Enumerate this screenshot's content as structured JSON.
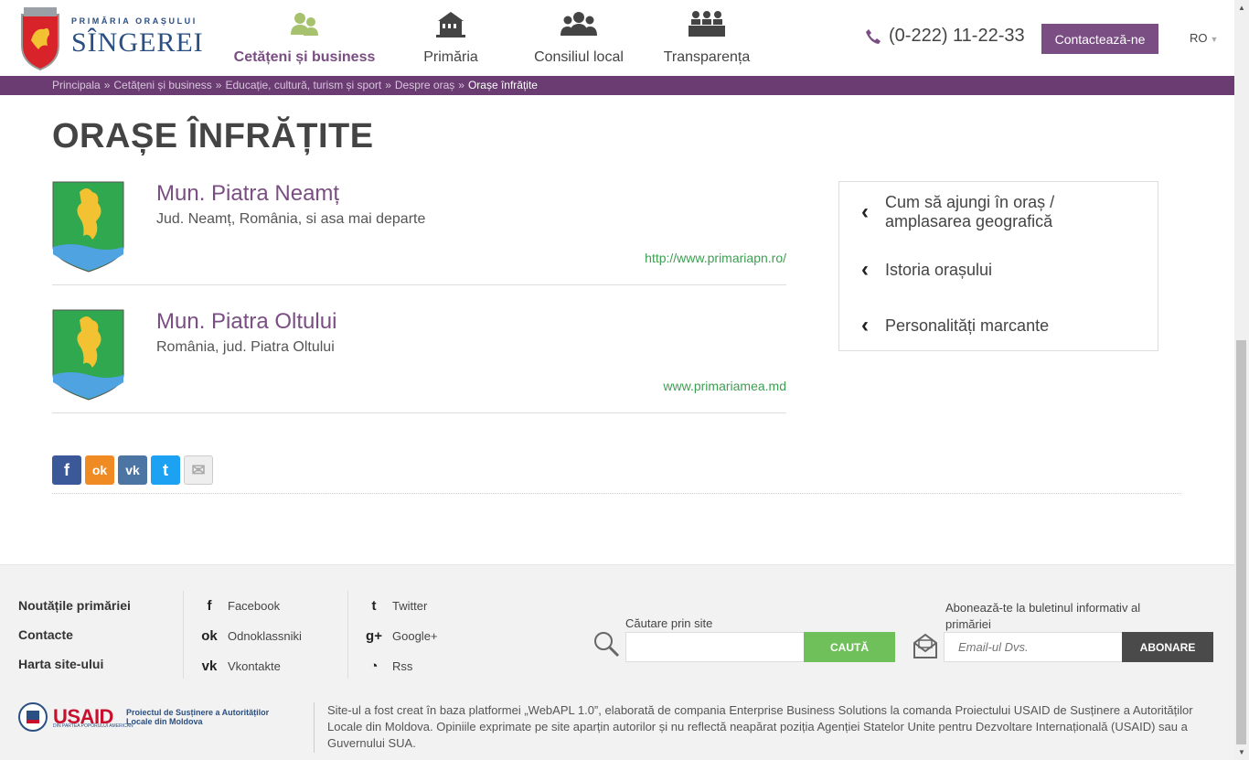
{
  "header": {
    "logo_small": "PRIMĂRIA ORAȘULUI",
    "logo_big": "SÎNGEREI",
    "nav": [
      {
        "label": "Cetățeni și business",
        "icon": "citizens-icon",
        "active": true
      },
      {
        "label": "Primăria",
        "icon": "building-icon",
        "active": false
      },
      {
        "label": "Consiliul local",
        "icon": "council-icon",
        "active": false
      },
      {
        "label": "Transparența",
        "icon": "meeting-icon",
        "active": false
      }
    ],
    "phone": "(0-222) 11-22-33",
    "contact_label": "Contactează-ne",
    "lang": "RO"
  },
  "breadcrumb": {
    "items": [
      "Principala",
      "Cetățeni și business",
      "Educație, cultură, turism și sport",
      "Despre oraș"
    ],
    "separator": "»",
    "current": "Orașe înfrățite"
  },
  "main": {
    "title": "ORAȘE ÎNFRĂȚITE",
    "cities": [
      {
        "name": "Mun. Piatra Neamț",
        "desc": "Jud. Neamț, România, si asa mai departe",
        "url": "http://www.primariapn.ro/"
      },
      {
        "name": "Mun. Piatra Oltului",
        "desc": "România, jud. Piatra Oltului",
        "url": "www.primariamea.md"
      }
    ],
    "side_menu": [
      {
        "label_line1": "Cum să ajungi în oraș /",
        "label_line2": "amplasarea geografică"
      },
      {
        "label_line1": "Istoria orașului",
        "label_line2": ""
      },
      {
        "label_line1": "Personalități marcante",
        "label_line2": ""
      }
    ],
    "share": [
      {
        "name": "facebook-share",
        "glyph": "f",
        "color": "#3b5998"
      },
      {
        "name": "odnoklassniki-share",
        "glyph": "ok",
        "color": "#f08a22"
      },
      {
        "name": "vkontakte-share",
        "glyph": "vk",
        "color": "#4c75a3"
      },
      {
        "name": "twitter-share",
        "glyph": "t",
        "color": "#1da1f2"
      },
      {
        "name": "email-share",
        "glyph": "✉",
        "color": "#e8e8e8"
      }
    ]
  },
  "footer": {
    "links": [
      "Noutățile primăriei",
      "Contacte",
      "Harta site-ului"
    ],
    "social_col1": [
      {
        "label": "Facebook",
        "glyph": "f"
      },
      {
        "label": "Odnoklassniki",
        "glyph": "ok"
      },
      {
        "label": "Vkontakte",
        "glyph": "vk"
      }
    ],
    "social_col2": [
      {
        "label": "Twitter",
        "glyph": "t"
      },
      {
        "label": "Google+",
        "glyph": "g+"
      },
      {
        "label": "Rss",
        "glyph": "rss"
      }
    ],
    "search_label": "Căutare prin site",
    "search_button": "CAUTĂ",
    "subscribe_label": "Abonează-te la buletinul informativ al primăriei",
    "subscribe_placeholder": "Email-ul Dvs.",
    "subscribe_button": "ABONARE",
    "usaid_word": "USAID",
    "usaid_sub": "DIN PARTEA POPORULUI AMERICAN",
    "usaid_project": "Proiectul de Susținere a Autorităților Locale din Moldova",
    "disclaimer": "Site-ul a fost creat în baza platformei „WebAPL 1.0”, elaborată de compania Enterprise Business Solutions la comanda Proiectului USAID de Susținere a Autorităților Locale din Moldova. Opiniile exprimate pe site aparțin autorilor și nu reflectă neapărat poziția Agenției Statelor Unite pentru Dezvoltare Internațională (USAID) sau a Guvernului SUA."
  },
  "colors": {
    "brand": "#7a4e83",
    "breadcrumb_bg": "#6a3c72",
    "link_green": "#3d9e52",
    "search_btn": "#6fbf5a"
  }
}
